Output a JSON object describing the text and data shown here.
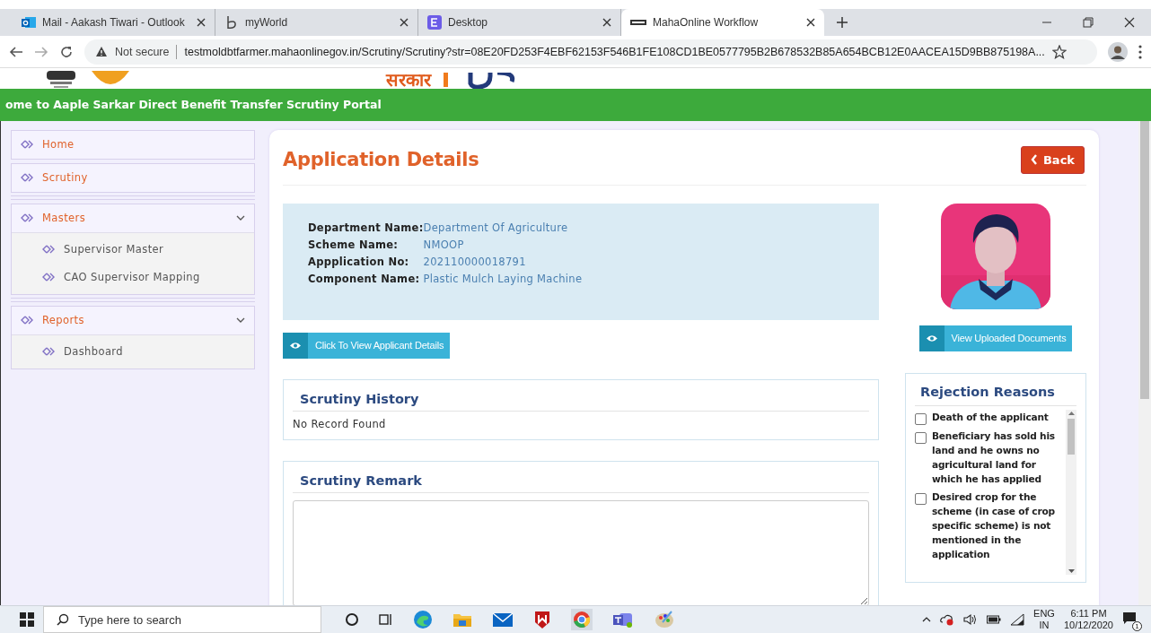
{
  "browser": {
    "tabs": [
      {
        "title": "Mail - Aakash Tiwari - Outlook",
        "selected": false
      },
      {
        "title": "myWorld",
        "selected": false
      },
      {
        "title": "Desktop",
        "selected": false
      },
      {
        "title": "MahaOnline Workflow",
        "selected": true
      }
    ],
    "security": "Not secure",
    "url": "testmoldbtfarmer.mahaonlinegov.in/Scrutiny/Scrutiny?str=08E20FD253F4EBF62153F546B1FE108CD1BE0577795B2B678532B85A654BCB12E0AACEA15D9BB875198A..."
  },
  "header": {
    "logo_text": "सरकार"
  },
  "banner": "ome to Aaple Sarkar Direct Benefit Transfer Scrutiny Portal",
  "sidebar": {
    "items": [
      {
        "label": "Home"
      },
      {
        "label": "Scrutiny"
      },
      {
        "label": "Masters",
        "expanded": true,
        "children": [
          {
            "label": "Supervisor Master"
          },
          {
            "label": "CAO Supervisor Mapping"
          }
        ]
      },
      {
        "label": "Reports",
        "expanded": true,
        "children": [
          {
            "label": "Dashboard"
          }
        ]
      }
    ]
  },
  "main": {
    "title": "Application Details",
    "back_button": "Back",
    "fields": [
      {
        "label": "Department Name:",
        "value": "Department Of Agriculture"
      },
      {
        "label": "Scheme Name:",
        "value": "NMOOP"
      },
      {
        "label": "Appplication No:",
        "value": "202110000018791"
      },
      {
        "label": "Component Name:",
        "value": "Plastic Mulch Laying Machine"
      }
    ],
    "applicant_button": "Click To View Applicant Details",
    "documents_button": "View Uploaded Documents",
    "history": {
      "title": "Scrutiny History",
      "empty_text": "No Record Found"
    },
    "remark": {
      "title": "Scrutiny Remark"
    },
    "rejection": {
      "title": "Rejection Reasons",
      "reasons": [
        {
          "text": "Death of the applicant",
          "checked": false
        },
        {
          "text": "Beneficiary has sold his land and he owns no agricultural land for which he has applied",
          "checked": false
        },
        {
          "text": "Desired crop for the scheme (in case of crop specific scheme) is not mentioned in the application",
          "checked": false
        }
      ]
    }
  },
  "taskbar": {
    "search_placeholder": "Type here to search",
    "language": "ENG",
    "region": "IN",
    "time": "6:11 PM",
    "date": "10/12/2020",
    "notification_count": "1"
  }
}
